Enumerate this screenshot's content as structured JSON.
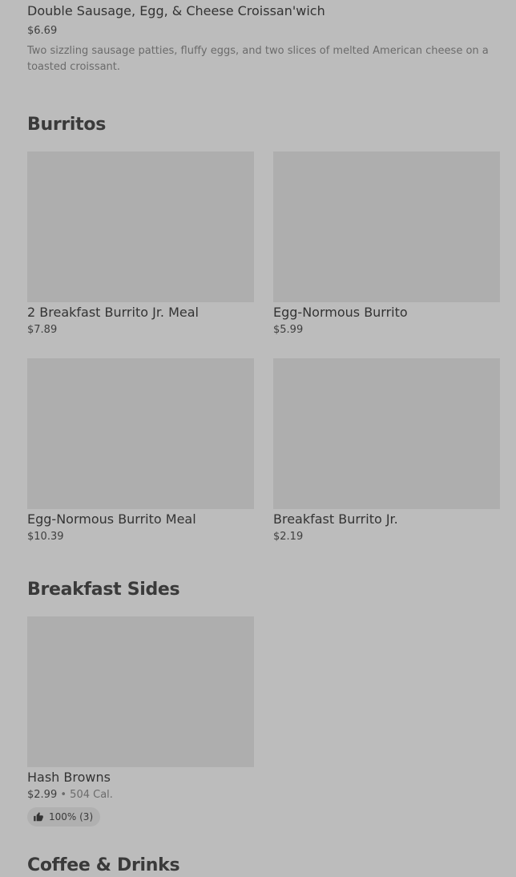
{
  "top_item": {
    "name": "Double Sausage, Egg, & Cheese Croissan'wich",
    "price": "$6.69",
    "description": "Two sizzling sausage patties, fluffy eggs, and two slices of melted American cheese on a toasted croissant."
  },
  "sections": {
    "burritos": {
      "title": "Burritos",
      "items": [
        {
          "name": "2 Breakfast Burrito Jr. Meal",
          "price": "$7.89"
        },
        {
          "name": "Egg-Normous Burrito",
          "price": "$5.99"
        },
        {
          "name": "Egg-Normous Burrito Meal",
          "price": "$10.39"
        },
        {
          "name": "Breakfast Burrito Jr.",
          "price": "$2.19"
        }
      ]
    },
    "breakfast_sides": {
      "title": "Breakfast Sides",
      "items": [
        {
          "name": "Hash Browns",
          "price": "$2.99",
          "separator": "•",
          "calories": "504 Cal.",
          "rating": "100% (3)"
        }
      ]
    },
    "coffee_drinks": {
      "title": "Coffee & Drinks"
    }
  },
  "icons": {
    "rating": "thumbs-up-icon"
  },
  "colors": {
    "background": "#bcbcbc",
    "image_placeholder": "#aeaeae",
    "text": "#333333",
    "muted_text": "#6b6b6b"
  }
}
